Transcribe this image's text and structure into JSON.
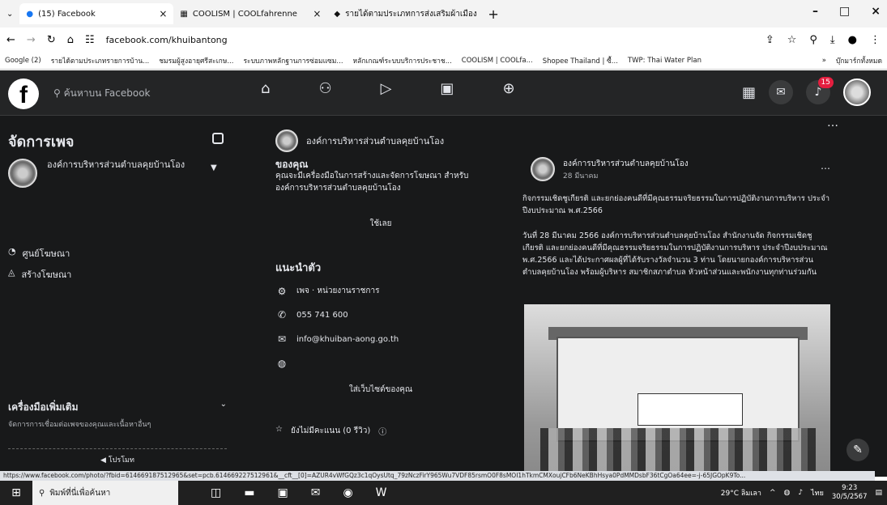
{
  "tabs": [
    {
      "icon": "facebook-icon",
      "title": "(15) Facebook"
    },
    {
      "icon": "coolism-icon",
      "title": "COOLISM | COOLfahrenne"
    },
    {
      "icon": "tab-page-icon",
      "title": "รายได้ตามประเภทการส่งเสริมผ้าเมือง"
    }
  ],
  "address": {
    "url": "facebook.com/khuibantong"
  },
  "bookmarks": [
    "Google (2)",
    "รายได้ตามประเภทรายการบ้าน...",
    "ชมรมผู้สูงอายุศรีสะเกษ...",
    "ระบบภาพหลักฐานการซ่อมแซม...",
    "หลักเกณฑ์ระบบบริการประชาช...",
    "COOLISM | COOLfa...",
    "Shopee Thailand | ซื้...",
    "TWP: Thai Water Plan",
    "»",
    "บุ๊กมาร์กทั้งหมด"
  ],
  "fb": {
    "search_placeholder": "ค้นหาบน Facebook",
    "notif_count": "15",
    "sidebar": {
      "title": "จัดการเพจ",
      "page_name": "องค์การบริหารส่วนตำบลคุยบ้านโอง",
      "items": [
        "ศูนย์โฆษณา",
        "สร้างโฆษณา"
      ],
      "tools_title": "เครื่องมือเพิ่มเติม",
      "tools_sub": "จัดการการเชื่อมต่อเพจของคุณและเนื้อหาอื่นๆ",
      "promote_label": "โปรโมท"
    },
    "mid": {
      "page_title": "องค์การบริหารส่วนตำบลคุยบ้านโอง",
      "your_heading": "ของคุณ",
      "your_desc": "คุณจะมีเครื่องมือในการสร้างและจัดการโฆษณา สำหรับ องค์การบริหารส่วนตำบลคุยบ้านโอง",
      "see_all": "ใช้เลย",
      "intro_heading": "แนะนำตัว",
      "intro_rows": [
        {
          "icon": "category-icon",
          "text": "เพจ · หน่วยงานราชการ"
        },
        {
          "icon": "phone-icon",
          "text": "055 741 600"
        },
        {
          "icon": "email-icon",
          "text": "info@khuiban-aong.go.th"
        },
        {
          "icon": "globe-icon",
          "text": ""
        }
      ],
      "add_website": "ใส่เว็บไซต์ของคุณ",
      "rating": "ยังไม่มีคะแนน (0 รีวิว)"
    },
    "post": {
      "author": "องค์การบริหารส่วนตำบลคุยบ้านโอง",
      "date": "28 มีนาคม",
      "para1": "กิจกรรมเชิดชูเกียรติ และยกย่องคนดีที่มีคุณธรรมจริยธรรมในการปฏิบัติงานการบริหาร ประจำปีงบประมาณ พ.ศ.2566",
      "para2": "วันที่ 28 มีนาคม 2566 องค์การบริหารส่วนตำบลคุยบ้านโอง สำนักงานจัด กิจกรรมเชิดชูเกียรติ และยกย่องคนดีที่มีคุณธรรมจริยธรรมในการปฏิบัติงานการบริหาร ประจำปีงบประมาณ พ.ศ.2566 และได้ประกาศผลผู้ที่ได้รับรางวัลจำนวน 3 ท่าน โดยนายกองค์การบริหารส่วนตำบลคุยบ้านโอง พร้อมผู้บริหาร สมาชิกสภาตำบล หัวหน้าส่วนและพนักงานทุกท่านร่วมกัน"
    }
  },
  "status_url": "https://www.facebook.com/photo/?fbid=614669187512965&set=pcb.614669227512961&__cft__[0]=AZUR4vWfGQz3c1qOysUtq_79zNczFirY965Wu7VDF85rsmO0F8sMOI1hTkmCMXoujCFb6NeKBhHsya0PdMMDsbF36tCgOa64ee=-j-65JGOpK9To...",
  "taskbar": {
    "search_placeholder": "พิมพ์ที่นี่เพื่อค้นหา",
    "weather": "29°C ลิมเลา",
    "lang": "ไทย",
    "time": "9:23",
    "date": "30/5/2567"
  }
}
